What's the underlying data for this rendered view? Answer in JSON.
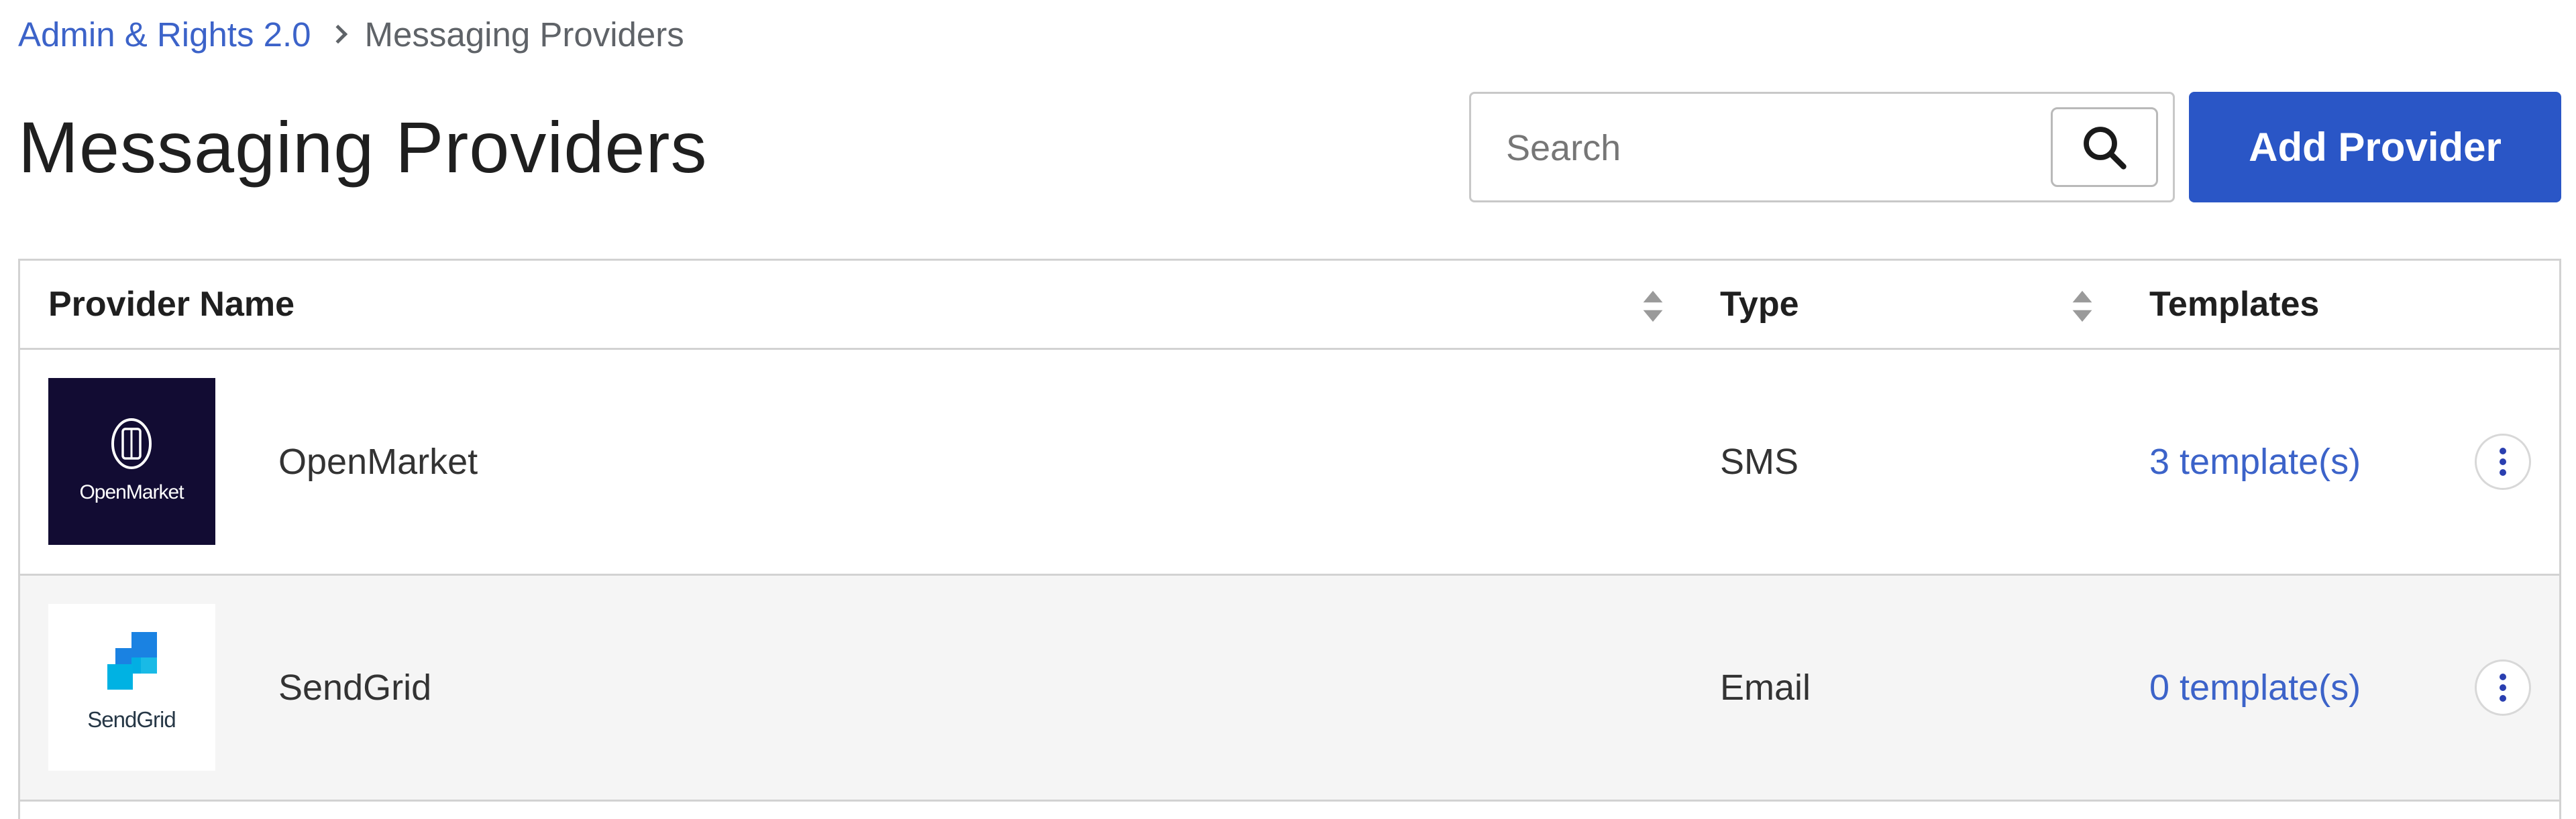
{
  "breadcrumb": {
    "parent": "Admin & Rights 2.0",
    "current": "Messaging Providers"
  },
  "page": {
    "title": "Messaging Providers"
  },
  "search": {
    "placeholder": "Search",
    "value": ""
  },
  "toolbar": {
    "add_label": "Add Provider"
  },
  "table": {
    "columns": {
      "name": "Provider Name",
      "type": "Type",
      "templates": "Templates"
    },
    "rows": [
      {
        "name": "OpenMarket",
        "type": "SMS",
        "templates": "3 template(s)",
        "logo_text": "OpenMarket",
        "logo_bg": "#120c33"
      },
      {
        "name": "SendGrid",
        "type": "Email",
        "templates": "0 template(s)",
        "logo_text": "SendGrid",
        "logo_bg": "#ffffff"
      }
    ]
  },
  "colors": {
    "accent": "#2a56c6",
    "link": "#3c63c9",
    "border": "#d2d2d2"
  },
  "icons": {
    "search": "search-icon",
    "sort": "sort-icon",
    "more": "kebab-menu-icon"
  }
}
